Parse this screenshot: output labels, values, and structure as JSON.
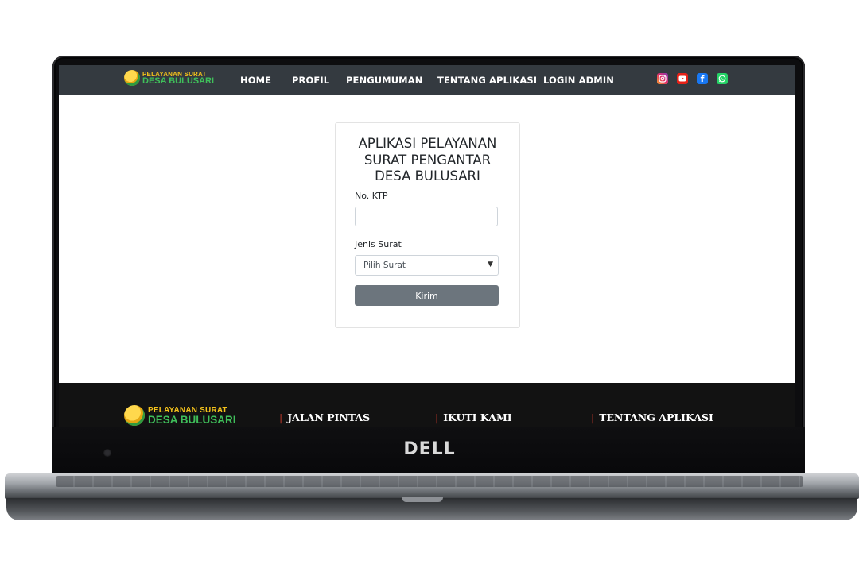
{
  "navbar": {
    "logo_line1": "PELAYANAN SURAT",
    "logo_line2": "DESA BULUSARI",
    "items": [
      {
        "label": "HOME"
      },
      {
        "label": "PROFIL"
      },
      {
        "label": "PENGUMUMAN"
      },
      {
        "label": "TENTANG APLIKASI"
      },
      {
        "label": "LOGIN ADMIN"
      }
    ],
    "social_icons": [
      "instagram-icon",
      "youtube-icon",
      "facebook-icon",
      "whatsapp-icon"
    ]
  },
  "form": {
    "title": "APLIKASI PELAYANAN SURAT PENGANTAR DESA BULUSARI",
    "title_lines": [
      "APLIKASI PELAYANAN",
      "SURAT PENGANTAR",
      "DESA BULUSARI"
    ],
    "ktp_label": "No. KTP",
    "ktp_value": "",
    "jenis_label": "Jenis Surat",
    "jenis_selected": "Pilih Surat",
    "submit_label": "Kirim"
  },
  "footer": {
    "logo_line1": "PELAYANAN SURAT",
    "logo_line2": "DESA BULUSARI",
    "sections": [
      {
        "title": "JALAN PINTAS"
      },
      {
        "title": "IKUTI KAMI"
      },
      {
        "title": "TENTANG APLIKASI"
      }
    ]
  },
  "device": {
    "brand": "DELL"
  },
  "colors": {
    "navbar_bg": "#343a40",
    "footer_bg": "#121212",
    "button_bg": "#6c757d",
    "footer_accent": "#c0392b"
  }
}
